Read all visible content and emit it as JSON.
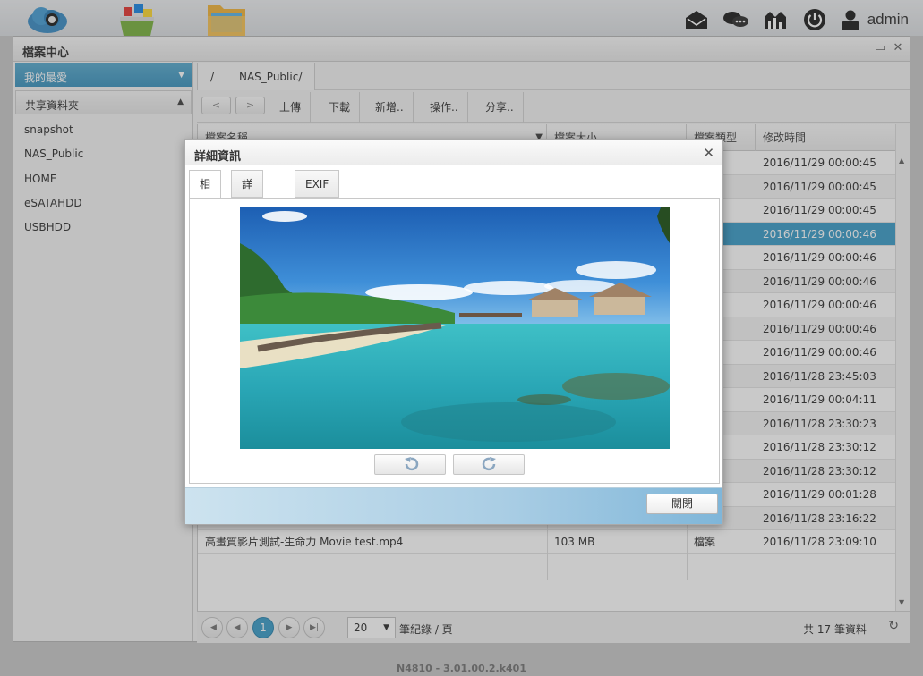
{
  "topbar": {
    "admin_label": "admin"
  },
  "window": {
    "title": "檔案中心"
  },
  "sidebar": {
    "favorites_label": "我的最愛",
    "shared_header": "共享資料夾",
    "items": [
      "snapshot",
      "NAS_Public",
      "HOME",
      "eSATAHDD",
      "USBHDD"
    ]
  },
  "path": {
    "root": "/",
    "current": "NAS_Public/"
  },
  "toolbar": {
    "upload": "上傳",
    "download": "下載",
    "new": "新增..",
    "action": "操作..",
    "share": "分享.."
  },
  "grid": {
    "columns": [
      "檔案名稱",
      "檔案大小",
      "檔案類型",
      "修改時間"
    ],
    "rows": [
      {
        "name": "",
        "size": "",
        "type": "",
        "modified": "2016/11/29 00:00:45"
      },
      {
        "name": "",
        "size": "",
        "type": "",
        "modified": "2016/11/29 00:00:45"
      },
      {
        "name": "",
        "size": "",
        "type": "",
        "modified": "2016/11/29 00:00:45"
      },
      {
        "name": "",
        "size": "",
        "type": "",
        "modified": "2016/11/29 00:00:46"
      },
      {
        "name": "",
        "size": "",
        "type": "",
        "modified": "2016/11/29 00:00:46"
      },
      {
        "name": "",
        "size": "",
        "type": "",
        "modified": "2016/11/29 00:00:46"
      },
      {
        "name": "",
        "size": "",
        "type": "",
        "modified": "2016/11/29 00:00:46"
      },
      {
        "name": "",
        "size": "",
        "type": "",
        "modified": "2016/11/29 00:00:46"
      },
      {
        "name": "",
        "size": "",
        "type": "",
        "modified": "2016/11/29 00:00:46"
      },
      {
        "name": "",
        "size": "",
        "type": "",
        "modified": "2016/11/28 23:45:03"
      },
      {
        "name": "",
        "size": "",
        "type": "",
        "modified": "2016/11/29 00:04:11"
      },
      {
        "name": "",
        "size": "",
        "type": "",
        "modified": "2016/11/28 23:30:23"
      },
      {
        "name": "",
        "size": "",
        "type": "",
        "modified": "2016/11/28 23:30:12"
      },
      {
        "name": "",
        "size": "",
        "type": "",
        "modified": "2016/11/28 23:30:12"
      },
      {
        "name": "",
        "size": "",
        "type": "",
        "modified": "2016/11/29 00:01:28"
      },
      {
        "name": "",
        "size": "",
        "type": "",
        "modified": "2016/11/28 23:16:22"
      },
      {
        "name": "高畫質影片測試-生命力 Movie test.mp4",
        "size": "103 MB",
        "type": "檔案",
        "modified": "2016/11/28 23:09:10"
      }
    ]
  },
  "pager": {
    "current_page": "1",
    "per_page": "20",
    "per_page_label": "筆紀錄 / 頁",
    "total": "共 17 筆資料"
  },
  "dialog": {
    "title": "詳細資訊",
    "tabs": [
      "相片",
      "詳細資訊",
      "EXIF"
    ],
    "close_label": "關閉"
  },
  "footer": {
    "version": "N4810 - 3.01.00.2.k401"
  },
  "colors": {
    "accent": "#3f9fca",
    "selected_row": "#3f9fca"
  }
}
